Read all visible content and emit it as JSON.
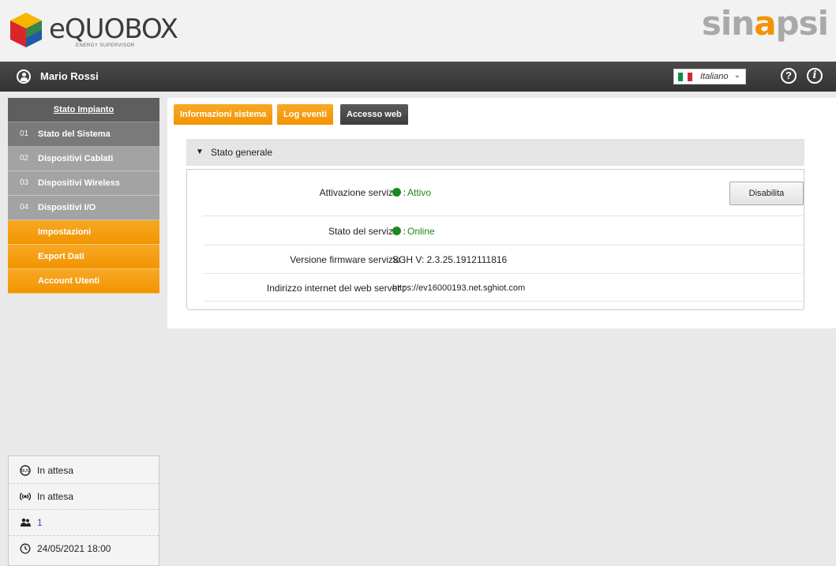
{
  "header": {
    "logo_text": "eQUOBOX",
    "logo_subtitle": "ENERGY SUPERVISOR",
    "brand_text": "sinapsi"
  },
  "topbar": {
    "user_name": "Mario Rossi",
    "language": "Italiano",
    "flag_colors": [
      "#009246",
      "#ffffff",
      "#ce2b37"
    ]
  },
  "sidebar": {
    "title": "Stato Impianto",
    "items": [
      {
        "num": "01",
        "label": "Stato del Sistema"
      },
      {
        "num": "02",
        "label": "Dispositivi Cablati"
      },
      {
        "num": "03",
        "label": "Dispositivi Wireless"
      },
      {
        "num": "04",
        "label": "Dispositivi I/O"
      }
    ],
    "menu": [
      {
        "label": "Impostazioni"
      },
      {
        "label": "Export Dati"
      },
      {
        "label": "Account Utenti"
      }
    ]
  },
  "tabs": [
    {
      "label": "Informazioni sistema"
    },
    {
      "label": "Log eventi"
    },
    {
      "label": "Accesso web"
    }
  ],
  "panel": {
    "title": "Stato generale",
    "rows": [
      {
        "key": "Attivazione servizio :",
        "value": "Attivo"
      },
      {
        "key": "Stato del servizio :",
        "value": "Online"
      },
      {
        "key": "Versione firmware servizio :",
        "value": "SGH V: 2.3.25.1912111816"
      },
      {
        "key": "Indirizzo internet del web server :",
        "value": "https://ev16000193.net.sghiot.com"
      }
    ],
    "button_label": "Disabilita"
  },
  "status": {
    "items": [
      {
        "icon": "bus-icon",
        "text": "In attesa"
      },
      {
        "icon": "wireless-icon",
        "text": "In attesa"
      },
      {
        "icon": "users-icon",
        "text": "1"
      },
      {
        "icon": "clock-icon",
        "text": "24/05/2021 18:00"
      }
    ]
  },
  "colors": {
    "orange": "#f29400",
    "dark_bar": "#3a3a3a",
    "status_green": "#1a8a1a",
    "link_blue": "#2e48c9"
  }
}
